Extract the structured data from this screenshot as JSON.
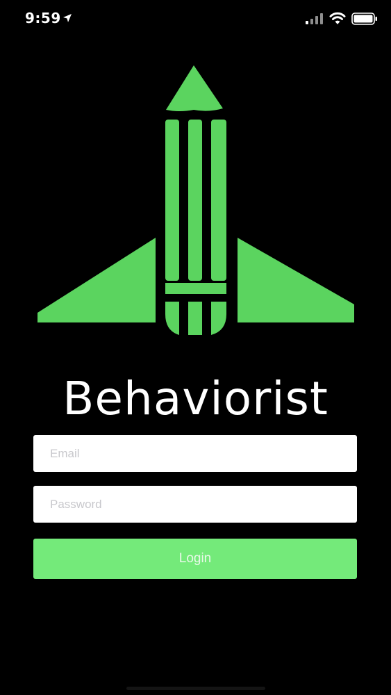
{
  "status_bar": {
    "time": "9:59",
    "icons": [
      "location-arrow-icon",
      "cellular-signal-icon",
      "wifi-icon",
      "battery-icon"
    ]
  },
  "logo": {
    "icon": "pencil-rocket-logo",
    "color": "#5bd45f"
  },
  "app": {
    "title": "Behaviorist"
  },
  "form": {
    "email_placeholder": "Email",
    "email_value": "",
    "password_placeholder": "Password",
    "password_value": "",
    "login_label": "Login"
  },
  "colors": {
    "background": "#000000",
    "accent": "#74ea7a",
    "logo": "#5bd45f",
    "title": "#ffffff"
  }
}
